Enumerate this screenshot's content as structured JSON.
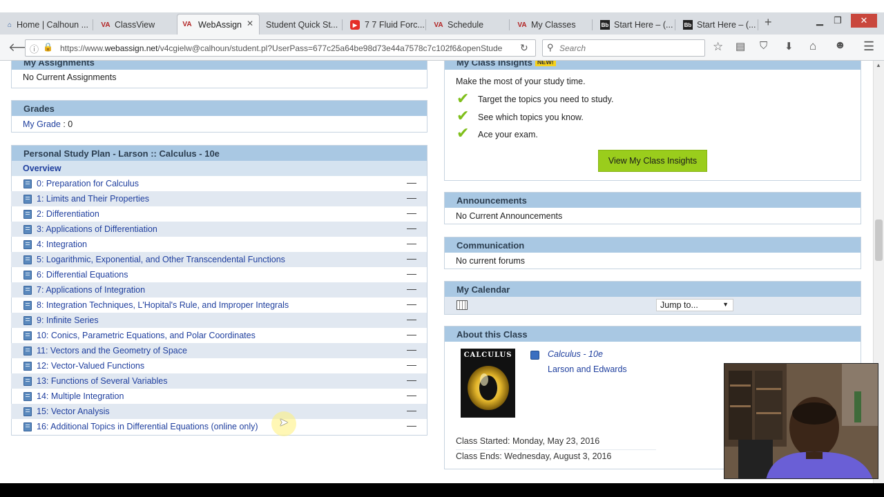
{
  "browser": {
    "tabs": [
      {
        "label": "Home | Calhoun ...",
        "favicon": "home-icon"
      },
      {
        "label": "ClassView",
        "favicon": "webassign-icon"
      },
      {
        "label": "WebAssign",
        "favicon": "webassign-icon"
      },
      {
        "label": "Student Quick St...",
        "favicon": "none"
      },
      {
        "label": "7 7 Fluid Forc...",
        "favicon": "youtube-icon"
      },
      {
        "label": "Schedule",
        "favicon": "webassign-icon"
      },
      {
        "label": "My Classes",
        "favicon": "webassign-icon"
      },
      {
        "label": "Start Here – (...",
        "favicon": "blackboard-icon"
      },
      {
        "label": "Start Here – (...",
        "favicon": "blackboard-icon"
      }
    ],
    "url_prefix": "https://www.",
    "url_host": "webassign.net",
    "url_rest": "/v4cgielw@calhoun/student.pl?UserPass=677c25a64be98d73e44a7578c7c102f6&openStude",
    "search_placeholder": "Search"
  },
  "assignments": {
    "title": "My Assignments",
    "text": "No Current Assignments"
  },
  "grades": {
    "title": "Grades",
    "link": "My Grade",
    "value": " : 0"
  },
  "study_plan": {
    "title": "Personal Study Plan - Larson :: Calculus - 10e",
    "overview": "Overview",
    "units": [
      "0: Preparation for Calculus",
      "1: Limits and Their Properties",
      "2: Differentiation",
      "3: Applications of Differentiation",
      "4: Integration",
      "5: Logarithmic, Exponential, and Other Transcendental Functions",
      "6: Differential Equations",
      "7: Applications of Integration",
      "8: Integration Techniques, L'Hopital's Rule, and Improper Integrals",
      "9: Infinite Series",
      "10: Conics, Parametric Equations, and Polar Coordinates",
      "11: Vectors and the Geometry of Space",
      "12: Vector-Valued Functions",
      "13: Functions of Several Variables",
      "14: Multiple Integration",
      "15: Vector Analysis",
      "16: Additional Topics in Differential Equations (online only)"
    ],
    "dash": "—"
  },
  "insights": {
    "title": "My Class Insights",
    "badge": "NEW!",
    "intro": "Make the most of your study time.",
    "items": [
      "Target the topics you need to study.",
      "See which topics you know.",
      "Ace your exam."
    ],
    "button": "View My Class Insights"
  },
  "announcements": {
    "title": "Announcements",
    "text": "No Current Announcements"
  },
  "communication": {
    "title": "Communication",
    "text": "No current forums"
  },
  "calendar": {
    "title": "My Calendar",
    "jump": "Jump to..."
  },
  "about": {
    "title": "About this Class",
    "book_title": "Calculus - 10e",
    "authors": "Larson and Edwards",
    "cover_text": "CALCULUS",
    "started": "Class Started: Monday, May 23, 2016",
    "ends": "Class Ends: Wednesday, August 3, 2016"
  },
  "colors": {
    "panel_header": "#a9c8e3",
    "link": "#1f3f9e",
    "insight_button": "#9acd1c",
    "check": "#7fbf1a"
  }
}
